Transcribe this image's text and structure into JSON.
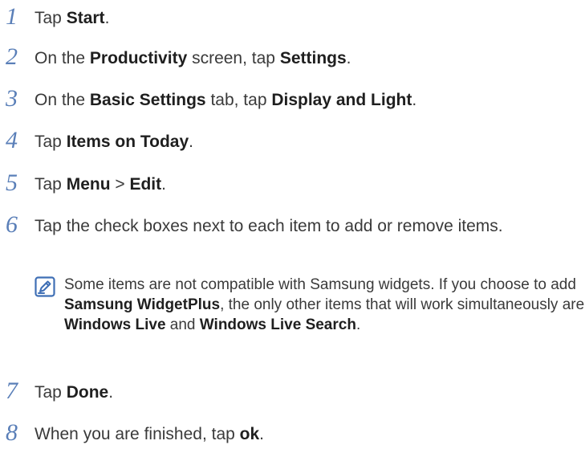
{
  "steps": [
    {
      "num": "1",
      "parts": [
        "Tap ",
        "Start",
        "."
      ]
    },
    {
      "num": "2",
      "parts": [
        "On the ",
        "Productivity",
        " screen, tap ",
        "Settings",
        "."
      ]
    },
    {
      "num": "3",
      "parts": [
        "On the ",
        "Basic Settings",
        " tab, tap ",
        "Display and Light",
        "."
      ]
    },
    {
      "num": "4",
      "parts": [
        "Tap ",
        "Items on Today",
        "."
      ]
    },
    {
      "num": "5",
      "parts": [
        "Tap ",
        "Menu",
        " > ",
        "Edit",
        "."
      ]
    },
    {
      "num": "6",
      "parts": [
        "Tap the check boxes next to each item to add or remove items."
      ]
    },
    {
      "num": "7",
      "parts": [
        "Tap ",
        "Done",
        "."
      ]
    },
    {
      "num": "8",
      "parts": [
        "When you are finished, tap ",
        "ok",
        "."
      ]
    }
  ],
  "note": {
    "icon": "note-pencil-icon",
    "parts": [
      "Some items are not compatible with Samsung widgets. If you choose to add ",
      "Samsung WidgetPlus",
      ", the only other items that will work simultaneously are ",
      "Windows Live",
      " and ",
      "Windows Live Search",
      "."
    ]
  },
  "colors": {
    "step_number": "#5a7fb8",
    "note_icon": "#3f6fb5",
    "text": "#3a3a3a"
  }
}
